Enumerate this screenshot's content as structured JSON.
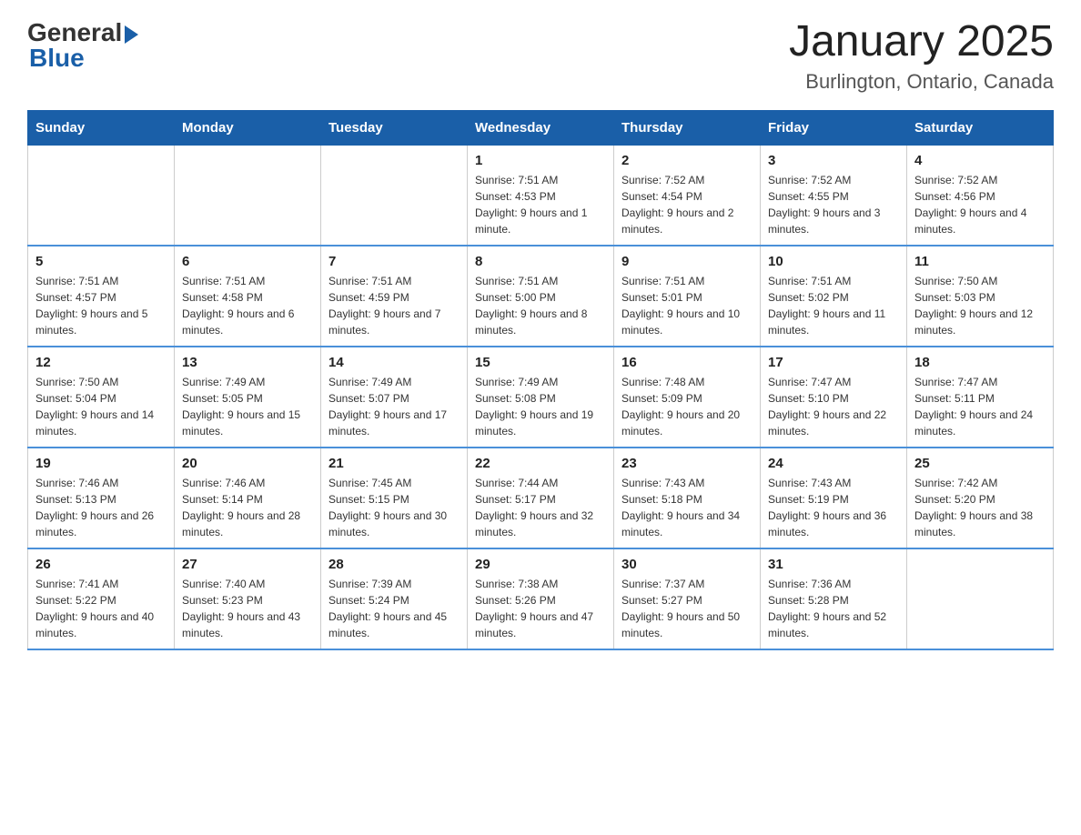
{
  "logo": {
    "general": "General",
    "blue": "Blue",
    "arrow": "▶"
  },
  "title": "January 2025",
  "subtitle": "Burlington, Ontario, Canada",
  "header": {
    "days": [
      "Sunday",
      "Monday",
      "Tuesday",
      "Wednesday",
      "Thursday",
      "Friday",
      "Saturday"
    ]
  },
  "weeks": [
    [
      {
        "day": "",
        "info": ""
      },
      {
        "day": "",
        "info": ""
      },
      {
        "day": "",
        "info": ""
      },
      {
        "day": "1",
        "info": "Sunrise: 7:51 AM\nSunset: 4:53 PM\nDaylight: 9 hours and 1 minute."
      },
      {
        "day": "2",
        "info": "Sunrise: 7:52 AM\nSunset: 4:54 PM\nDaylight: 9 hours and 2 minutes."
      },
      {
        "day": "3",
        "info": "Sunrise: 7:52 AM\nSunset: 4:55 PM\nDaylight: 9 hours and 3 minutes."
      },
      {
        "day": "4",
        "info": "Sunrise: 7:52 AM\nSunset: 4:56 PM\nDaylight: 9 hours and 4 minutes."
      }
    ],
    [
      {
        "day": "5",
        "info": "Sunrise: 7:51 AM\nSunset: 4:57 PM\nDaylight: 9 hours and 5 minutes."
      },
      {
        "day": "6",
        "info": "Sunrise: 7:51 AM\nSunset: 4:58 PM\nDaylight: 9 hours and 6 minutes."
      },
      {
        "day": "7",
        "info": "Sunrise: 7:51 AM\nSunset: 4:59 PM\nDaylight: 9 hours and 7 minutes."
      },
      {
        "day": "8",
        "info": "Sunrise: 7:51 AM\nSunset: 5:00 PM\nDaylight: 9 hours and 8 minutes."
      },
      {
        "day": "9",
        "info": "Sunrise: 7:51 AM\nSunset: 5:01 PM\nDaylight: 9 hours and 10 minutes."
      },
      {
        "day": "10",
        "info": "Sunrise: 7:51 AM\nSunset: 5:02 PM\nDaylight: 9 hours and 11 minutes."
      },
      {
        "day": "11",
        "info": "Sunrise: 7:50 AM\nSunset: 5:03 PM\nDaylight: 9 hours and 12 minutes."
      }
    ],
    [
      {
        "day": "12",
        "info": "Sunrise: 7:50 AM\nSunset: 5:04 PM\nDaylight: 9 hours and 14 minutes."
      },
      {
        "day": "13",
        "info": "Sunrise: 7:49 AM\nSunset: 5:05 PM\nDaylight: 9 hours and 15 minutes."
      },
      {
        "day": "14",
        "info": "Sunrise: 7:49 AM\nSunset: 5:07 PM\nDaylight: 9 hours and 17 minutes."
      },
      {
        "day": "15",
        "info": "Sunrise: 7:49 AM\nSunset: 5:08 PM\nDaylight: 9 hours and 19 minutes."
      },
      {
        "day": "16",
        "info": "Sunrise: 7:48 AM\nSunset: 5:09 PM\nDaylight: 9 hours and 20 minutes."
      },
      {
        "day": "17",
        "info": "Sunrise: 7:47 AM\nSunset: 5:10 PM\nDaylight: 9 hours and 22 minutes."
      },
      {
        "day": "18",
        "info": "Sunrise: 7:47 AM\nSunset: 5:11 PM\nDaylight: 9 hours and 24 minutes."
      }
    ],
    [
      {
        "day": "19",
        "info": "Sunrise: 7:46 AM\nSunset: 5:13 PM\nDaylight: 9 hours and 26 minutes."
      },
      {
        "day": "20",
        "info": "Sunrise: 7:46 AM\nSunset: 5:14 PM\nDaylight: 9 hours and 28 minutes."
      },
      {
        "day": "21",
        "info": "Sunrise: 7:45 AM\nSunset: 5:15 PM\nDaylight: 9 hours and 30 minutes."
      },
      {
        "day": "22",
        "info": "Sunrise: 7:44 AM\nSunset: 5:17 PM\nDaylight: 9 hours and 32 minutes."
      },
      {
        "day": "23",
        "info": "Sunrise: 7:43 AM\nSunset: 5:18 PM\nDaylight: 9 hours and 34 minutes."
      },
      {
        "day": "24",
        "info": "Sunrise: 7:43 AM\nSunset: 5:19 PM\nDaylight: 9 hours and 36 minutes."
      },
      {
        "day": "25",
        "info": "Sunrise: 7:42 AM\nSunset: 5:20 PM\nDaylight: 9 hours and 38 minutes."
      }
    ],
    [
      {
        "day": "26",
        "info": "Sunrise: 7:41 AM\nSunset: 5:22 PM\nDaylight: 9 hours and 40 minutes."
      },
      {
        "day": "27",
        "info": "Sunrise: 7:40 AM\nSunset: 5:23 PM\nDaylight: 9 hours and 43 minutes."
      },
      {
        "day": "28",
        "info": "Sunrise: 7:39 AM\nSunset: 5:24 PM\nDaylight: 9 hours and 45 minutes."
      },
      {
        "day": "29",
        "info": "Sunrise: 7:38 AM\nSunset: 5:26 PM\nDaylight: 9 hours and 47 minutes."
      },
      {
        "day": "30",
        "info": "Sunrise: 7:37 AM\nSunset: 5:27 PM\nDaylight: 9 hours and 50 minutes."
      },
      {
        "day": "31",
        "info": "Sunrise: 7:36 AM\nSunset: 5:28 PM\nDaylight: 9 hours and 52 minutes."
      },
      {
        "day": "",
        "info": ""
      }
    ]
  ]
}
